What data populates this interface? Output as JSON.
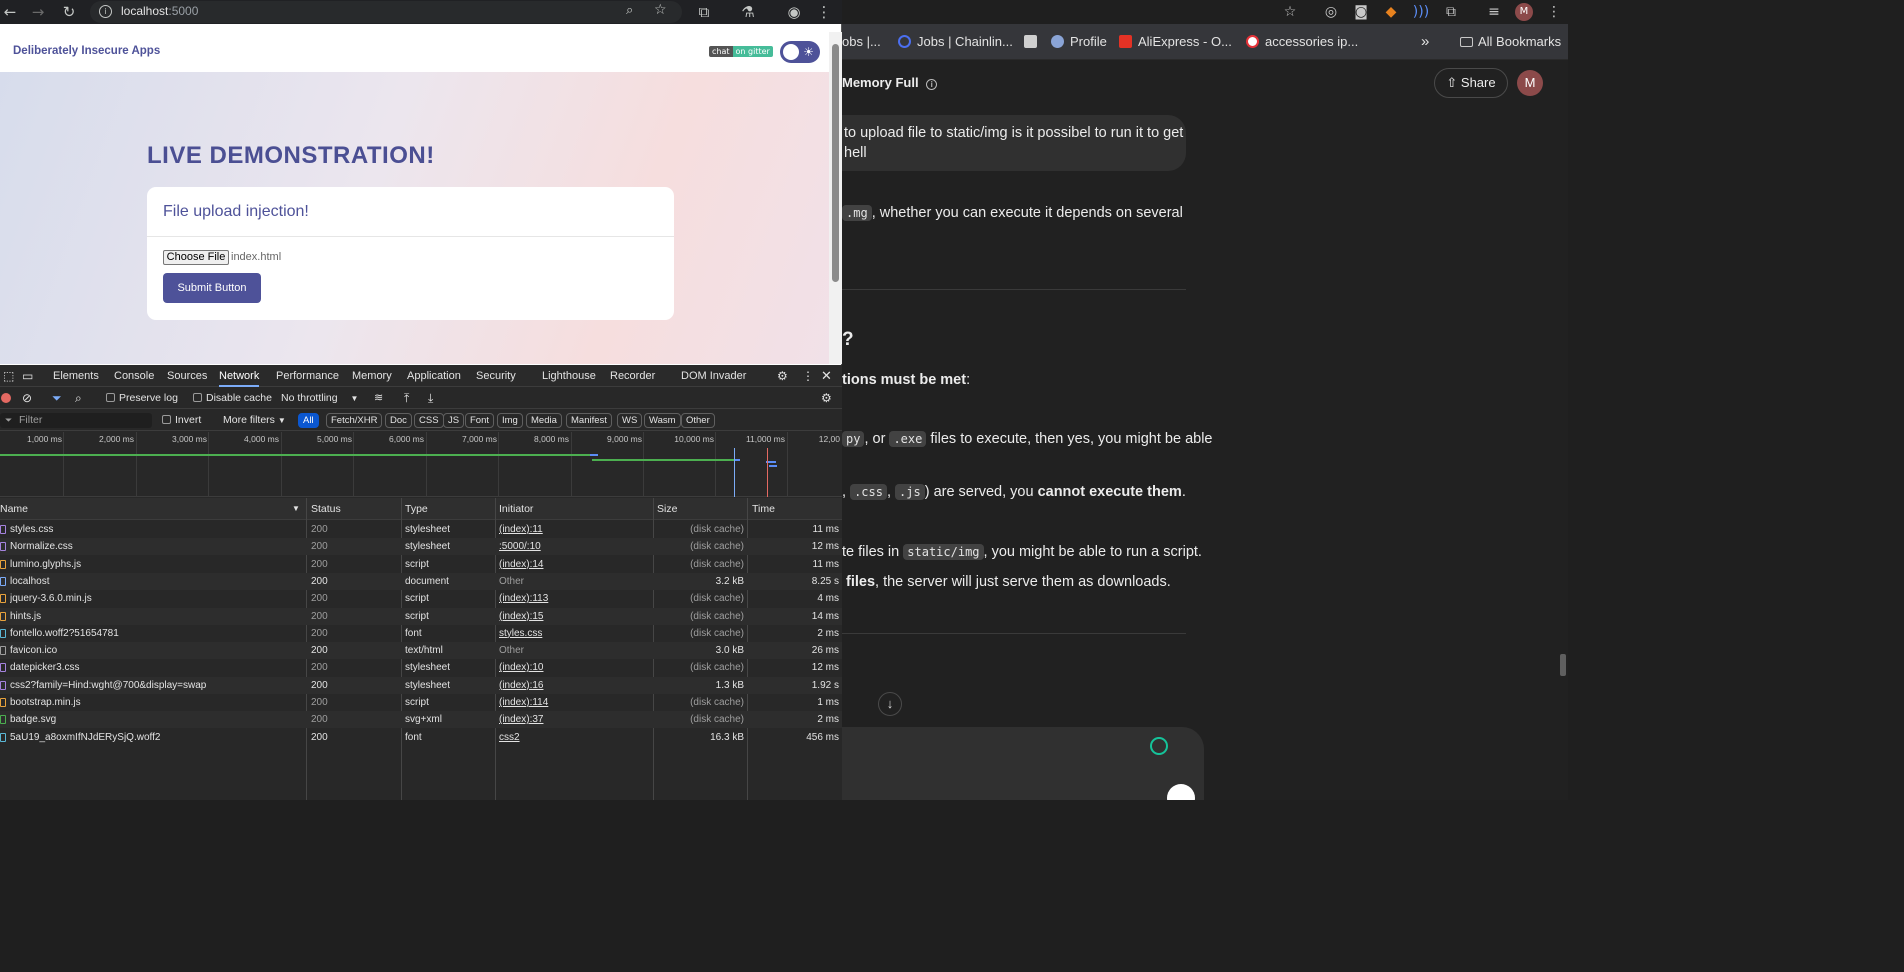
{
  "browser": {
    "url_host": "localhost",
    "url_port": ":5000"
  },
  "page": {
    "brand": "Deliberately Insecure Apps",
    "chat_badge_left": "chat",
    "chat_badge_right": "on gitter",
    "title": "LIVE DEMONSTRATION!",
    "card_title": "File upload injection!",
    "choose_file_label": "Choose File",
    "file_name": "index.html",
    "submit_label": "Submit Button"
  },
  "devtools": {
    "tabs": [
      "Elements",
      "Console",
      "Sources",
      "Network",
      "Performance",
      "Memory",
      "Application",
      "Security",
      "Lighthouse",
      "Recorder",
      "DOM Invader"
    ],
    "active_tab": "Network",
    "toolbar": {
      "preserve_log": "Preserve log",
      "disable_cache": "Disable cache",
      "throttling": "No throttling"
    },
    "filter": {
      "placeholder": "Filter",
      "invert": "Invert",
      "more_filters": "More filters",
      "types": [
        "All",
        "Fetch/XHR",
        "Doc",
        "CSS",
        "JS",
        "Font",
        "Img",
        "Media",
        "Manifest",
        "WS",
        "Wasm",
        "Other"
      ]
    },
    "timeline_ticks": [
      "1,000 ms",
      "2,000 ms",
      "3,000 ms",
      "4,000 ms",
      "5,000 ms",
      "6,000 ms",
      "7,000 ms",
      "8,000 ms",
      "9,000 ms",
      "10,000 ms",
      "11,000 ms",
      "12,00"
    ],
    "columns": [
      "Name",
      "Status",
      "Type",
      "Initiator",
      "Size",
      "Time"
    ],
    "rows": [
      {
        "name": "styles.css",
        "status": "200",
        "type": "stylesheet",
        "initiator": "(index):11",
        "size": "(disk cache)",
        "time": "11 ms",
        "icon": "css"
      },
      {
        "name": "Normalize.css",
        "status": "200",
        "type": "stylesheet",
        "initiator": ":5000/:10",
        "size": "(disk cache)",
        "time": "12 ms",
        "icon": "css"
      },
      {
        "name": "lumino.glyphs.js",
        "status": "200",
        "type": "script",
        "initiator": "(index):14",
        "size": "(disk cache)",
        "time": "11 ms",
        "icon": "js"
      },
      {
        "name": "localhost",
        "status": "200",
        "type": "document",
        "initiator": "Other",
        "size": "3.2 kB",
        "time": "8.25 s",
        "icon": "doc"
      },
      {
        "name": "jquery-3.6.0.min.js",
        "status": "200",
        "type": "script",
        "initiator": "(index):113",
        "size": "(disk cache)",
        "time": "4 ms",
        "icon": "js"
      },
      {
        "name": "hints.js",
        "status": "200",
        "type": "script",
        "initiator": "(index):15",
        "size": "(disk cache)",
        "time": "14 ms",
        "icon": "js"
      },
      {
        "name": "fontello.woff2?51654781",
        "status": "200",
        "type": "font",
        "initiator": "styles.css",
        "size": "(disk cache)",
        "time": "2 ms",
        "icon": "font"
      },
      {
        "name": "favicon.ico",
        "status": "200",
        "type": "text/html",
        "initiator": "Other",
        "size": "3.0 kB",
        "time": "26 ms",
        "icon": "other"
      },
      {
        "name": "datepicker3.css",
        "status": "200",
        "type": "stylesheet",
        "initiator": "(index):10",
        "size": "(disk cache)",
        "time": "12 ms",
        "icon": "css"
      },
      {
        "name": "css2?family=Hind:wght@700&display=swap",
        "status": "200",
        "type": "stylesheet",
        "initiator": "(index):16",
        "size": "1.3 kB",
        "time": "1.92 s",
        "icon": "css"
      },
      {
        "name": "bootstrap.min.js",
        "status": "200",
        "type": "script",
        "initiator": "(index):114",
        "size": "(disk cache)",
        "time": "1 ms",
        "icon": "js"
      },
      {
        "name": "badge.svg",
        "status": "200",
        "type": "svg+xml",
        "initiator": "(index):37",
        "size": "(disk cache)",
        "time": "2 ms",
        "icon": "img"
      },
      {
        "name": "5aU19_a8oxmIfNJdERySjQ.woff2",
        "status": "200",
        "type": "font",
        "initiator": "css2",
        "size": "16.3 kB",
        "time": "456 ms",
        "icon": "font"
      }
    ]
  },
  "right_window": {
    "bookmarks": [
      "obs |...",
      "Jobs | Chainlin...",
      "Profile",
      "AliExpress - O...",
      "accessories ip..."
    ],
    "all_bookmarks": "All Bookmarks",
    "chat_title": "Memory Full",
    "share_label": "Share",
    "avatar_letter": "M",
    "user_msg_line1": "to upload file to static/img is it possibel to run it to get",
    "user_msg_line2": "hell",
    "line1_code": ".mg",
    "line1_text": ", whether you can execute it depends on several",
    "heading": "?",
    "conditions_bold": "tions must be met",
    "conditions_tail": ":",
    "py_code": "py",
    "or_text": ", or",
    "exe_code": ".exe",
    "exe_tail": "files to execute, then yes, you might be able",
    "css_code": ".css",
    "js_code": ".js",
    "served_text": ") are served, you",
    "cannot_bold": "cannot execute them",
    "period": ".",
    "te_files": "te files in",
    "static_code": "static/img",
    "script_tail": ", you might be able to run a script.",
    "files_bold": "files",
    "download_tail": ", the server will just serve them as downloads."
  }
}
